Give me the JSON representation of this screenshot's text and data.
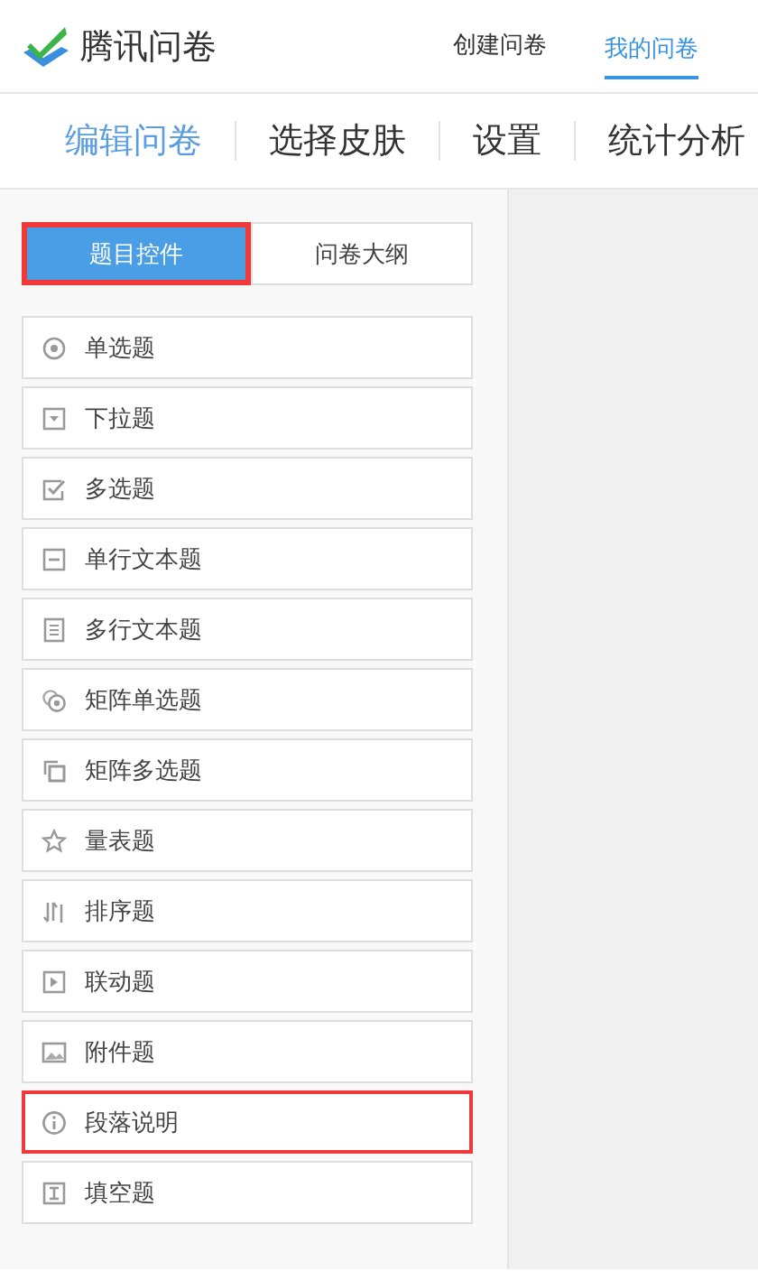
{
  "header": {
    "logo_text": "腾讯问卷",
    "nav": [
      {
        "label": "创建问卷",
        "selected": false
      },
      {
        "label": "我的问卷",
        "selected": true
      }
    ]
  },
  "tabs": [
    {
      "label": "编辑问卷",
      "selected": true
    },
    {
      "label": "选择皮肤",
      "selected": false
    },
    {
      "label": "设置",
      "selected": false
    },
    {
      "label": "统计分析",
      "selected": false
    }
  ],
  "panel_switch": [
    {
      "label": "题目控件",
      "selected": true,
      "highlighted": true
    },
    {
      "label": "问卷大纲",
      "selected": false,
      "highlighted": false
    }
  ],
  "controls": [
    {
      "kind": "radio",
      "label": "单选题",
      "highlighted": false
    },
    {
      "kind": "dropdown",
      "label": "下拉题",
      "highlighted": false
    },
    {
      "kind": "checkbox",
      "label": "多选题",
      "highlighted": false
    },
    {
      "kind": "single-line",
      "label": "单行文本题",
      "highlighted": false
    },
    {
      "kind": "multi-line",
      "label": "多行文本题",
      "highlighted": false
    },
    {
      "kind": "matrix-radio",
      "label": "矩阵单选题",
      "highlighted": false
    },
    {
      "kind": "matrix-checkbox",
      "label": "矩阵多选题",
      "highlighted": false
    },
    {
      "kind": "scale",
      "label": "量表题",
      "highlighted": false
    },
    {
      "kind": "sort",
      "label": "排序题",
      "highlighted": false
    },
    {
      "kind": "linked",
      "label": "联动题",
      "highlighted": false
    },
    {
      "kind": "attachment",
      "label": "附件题",
      "highlighted": false
    },
    {
      "kind": "paragraph",
      "label": "段落说明",
      "highlighted": true
    },
    {
      "kind": "fill-blank",
      "label": "填空题",
      "highlighted": false
    }
  ]
}
